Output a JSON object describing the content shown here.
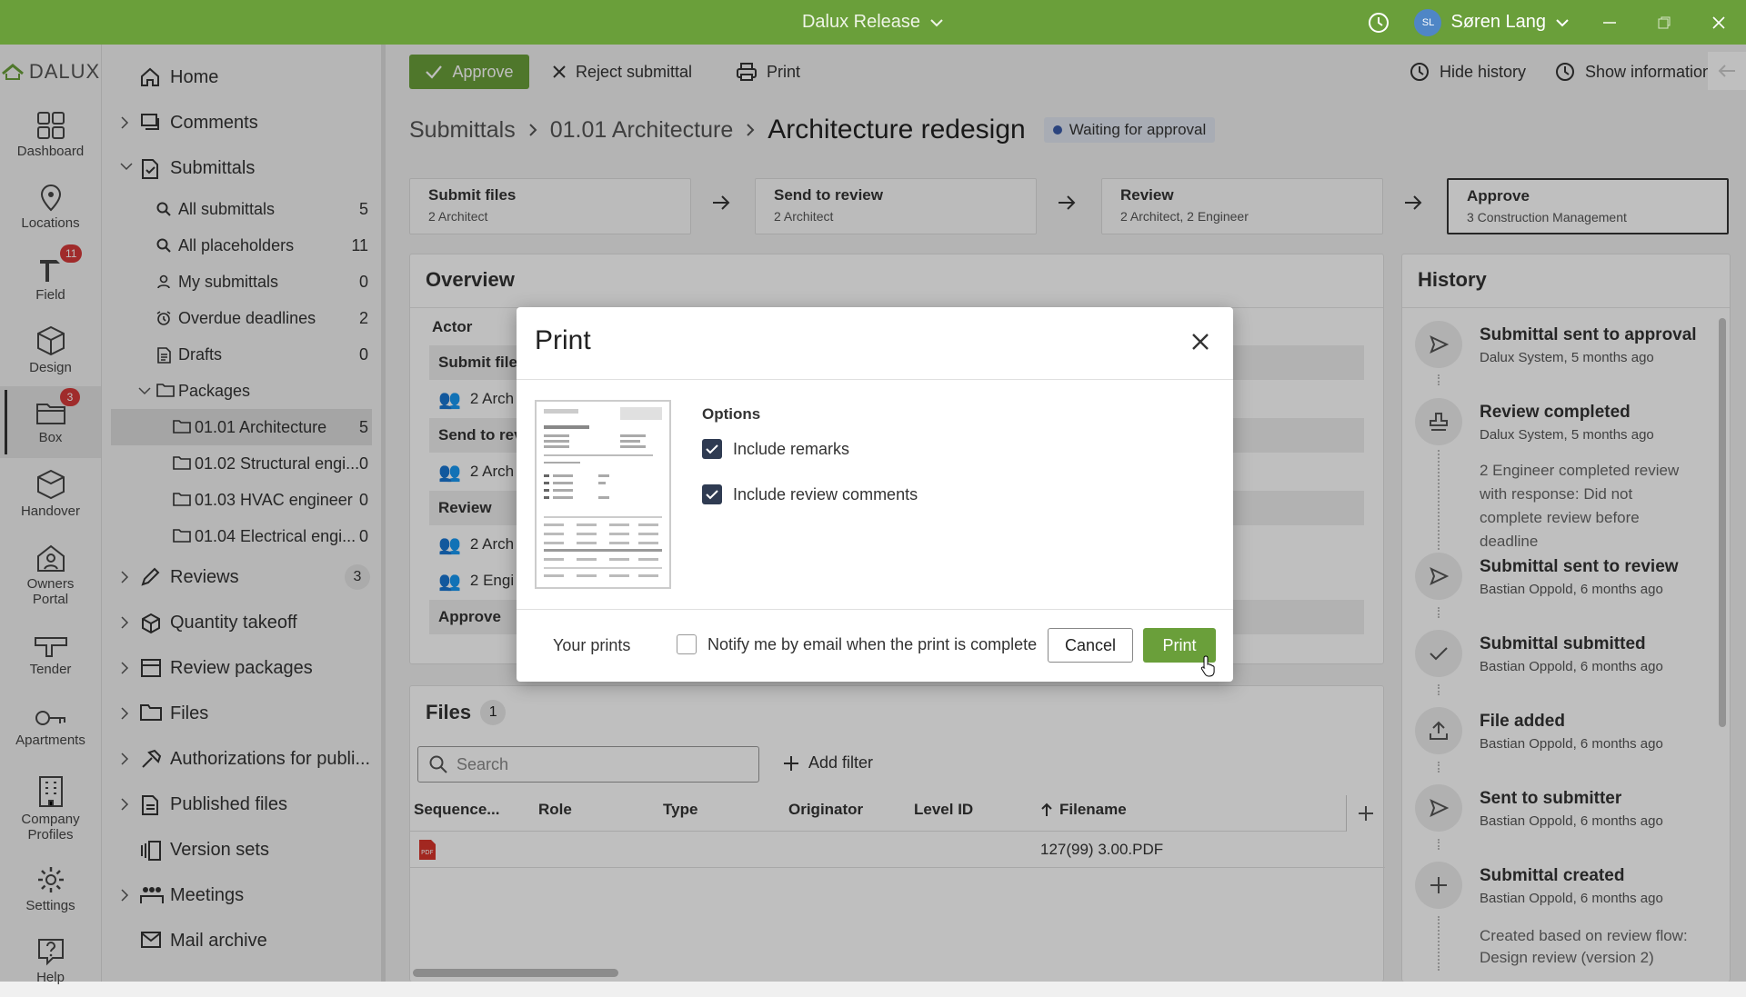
{
  "window": {
    "title": "Dalux Release",
    "user_initials": "SL",
    "user_name": "Søren Lang"
  },
  "rail": {
    "logo": "DALUX",
    "items": [
      {
        "label": "Dashboard",
        "icon": "dashboard-icon"
      },
      {
        "label": "Locations",
        "icon": "location-pin-icon"
      },
      {
        "label": "Field",
        "icon": "field-icon",
        "badge": "11"
      },
      {
        "label": "Design",
        "icon": "cube-icon"
      },
      {
        "label": "Box",
        "icon": "box-folder-icon",
        "badge": "3"
      },
      {
        "label": "Handover",
        "icon": "handover-icon"
      },
      {
        "label": "Owners Portal",
        "icon": "home-user-icon"
      },
      {
        "label": "Tender",
        "icon": "tender-icon"
      },
      {
        "label": "Apartments",
        "icon": "key-icon"
      },
      {
        "label": "Company Profiles",
        "icon": "building-icon"
      },
      {
        "label": "Settings",
        "icon": "gear-icon"
      },
      {
        "label": "Help",
        "icon": "help-icon"
      }
    ]
  },
  "nav": {
    "home": "Home",
    "comments": "Comments",
    "submittals": "Submittals",
    "sub_items": [
      {
        "label": "All submittals",
        "count": "5"
      },
      {
        "label": "All placeholders",
        "count": "11"
      },
      {
        "label": "My submittals",
        "count": "0"
      },
      {
        "label": "Overdue deadlines",
        "count": "2"
      },
      {
        "label": "Drafts",
        "count": "0"
      }
    ],
    "packages": "Packages",
    "package_items": [
      {
        "label": "01.01 Architecture",
        "count": "5"
      },
      {
        "label": "01.02 Structural engi...",
        "count": "0"
      },
      {
        "label": "01.03 HVAC engineer",
        "count": "0"
      },
      {
        "label": "01.04 Electrical engi...",
        "count": "0"
      }
    ],
    "reviews": "Reviews",
    "reviews_count": "3",
    "quantity_takeoff": "Quantity takeoff",
    "review_packages": "Review packages",
    "files": "Files",
    "authorizations": "Authorizations for publi...",
    "published_files": "Published files",
    "version_sets": "Version sets",
    "meetings": "Meetings",
    "mail_archive": "Mail archive"
  },
  "toolbar": {
    "approve": "Approve",
    "reject": "Reject submittal",
    "print": "Print",
    "hide_history": "Hide history",
    "show_information": "Show information"
  },
  "breadcrumb": {
    "root": "Submittals",
    "package": "01.01 Architecture",
    "current": "Architecture redesign",
    "status": "Waiting for approval"
  },
  "steps": [
    {
      "title": "Submit files",
      "sub": "2 Architect"
    },
    {
      "title": "Send to review",
      "sub": "2 Architect"
    },
    {
      "title": "Review",
      "sub": "2 Architect, 2 Engineer"
    },
    {
      "title": "Approve",
      "sub": "3 Construction Management"
    }
  ],
  "overview": {
    "title": "Overview",
    "actor_header": "Actor",
    "rows": [
      "Submit files",
      "2 Arch",
      "Send to rev",
      "2 Arch",
      "Review",
      "2 Arch",
      "2 Engi",
      "Approve"
    ]
  },
  "files": {
    "title": "Files",
    "count": "1",
    "search_placeholder": "Search",
    "add_filter": "Add filter",
    "columns": [
      "Sequence...",
      "Role",
      "Type",
      "Originator",
      "Level ID",
      "Filename"
    ],
    "rows": [
      {
        "filename": "127(99) 3.00.PDF"
      }
    ]
  },
  "history": {
    "title": "History",
    "items": [
      {
        "title": "Submittal sent to approval",
        "sub": "Dalux System, 5 months ago",
        "icon": "send-icon"
      },
      {
        "title": "Review completed",
        "sub": "Dalux System, 5 months ago",
        "icon": "stamp-icon",
        "note": "2 Engineer completed review with response: Did not complete review before deadline"
      },
      {
        "title": "Submittal sent to review",
        "sub": "Bastian Oppold, 6 months ago",
        "icon": "send-icon"
      },
      {
        "title": "Submittal submitted",
        "sub": "Bastian Oppold, 6 months ago",
        "icon": "check-icon"
      },
      {
        "title": "File added",
        "sub": "Bastian Oppold, 6 months ago",
        "icon": "upload-icon"
      },
      {
        "title": "Sent to submitter",
        "sub": "Bastian Oppold, 6 months ago",
        "icon": "send-icon"
      },
      {
        "title": "Submittal created",
        "sub": "Bastian Oppold, 6 months ago",
        "icon": "plus-icon",
        "note": "Created based on review flow: Design review (version 2)"
      }
    ]
  },
  "print_dialog": {
    "title": "Print",
    "options_heading": "Options",
    "include_remarks": "Include remarks",
    "include_remarks_checked": true,
    "include_review_comments": "Include review comments",
    "include_review_comments_checked": true,
    "your_prints": "Your prints",
    "notify_email": "Notify me by email when the print is complete",
    "notify_checked": false,
    "cancel": "Cancel",
    "print": "Print"
  },
  "colors": {
    "brand_green": "#6a9f3a",
    "status_blue": "#3a5ba9",
    "badge_red": "#d63a3a"
  }
}
